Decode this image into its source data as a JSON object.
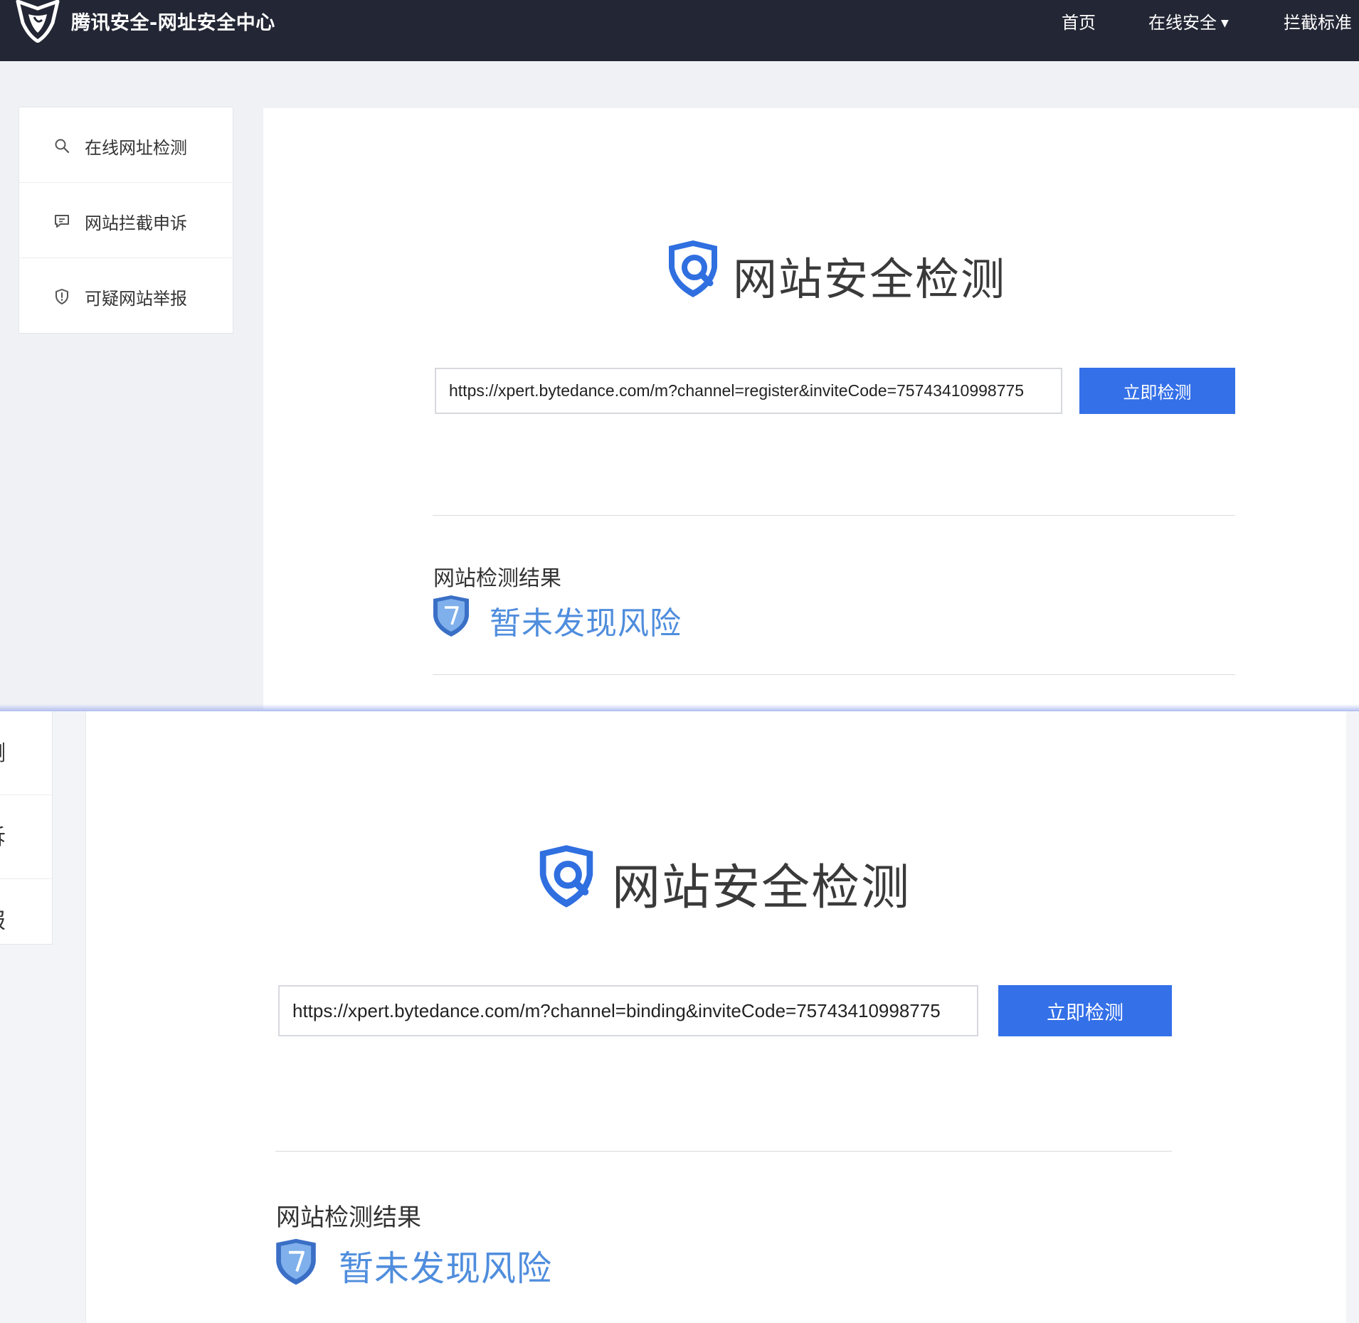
{
  "header": {
    "brand_title": "腾讯安全-网址安全中心",
    "nav": {
      "home": "首页",
      "online_security": "在线安全",
      "block_standard": "拦截标准"
    }
  },
  "sidebar": {
    "items": [
      {
        "label": "在线网址检测",
        "icon": "search-icon"
      },
      {
        "label": "网站拦截申诉",
        "icon": "chat-icon"
      },
      {
        "label": "可疑网站举报",
        "icon": "shield-alert-icon"
      }
    ],
    "partial_glyphs": [
      "测",
      "诉",
      "报"
    ]
  },
  "top_panel": {
    "hero_title": "网站安全检测",
    "url_value": "https://xpert.bytedance.com/m?channel=register&inviteCode=75743410998775",
    "button_label": "立即检测",
    "result_heading": "网站检测结果",
    "result_status": "暂未发现风险"
  },
  "bottom_panel": {
    "hero_title": "网站安全检测",
    "url_value": "https://xpert.bytedance.com/m?channel=binding&inviteCode=75743410998775",
    "button_label": "立即检测",
    "result_heading": "网站检测结果",
    "result_status": "暂未发现风险"
  },
  "colors": {
    "header_bg": "#232634",
    "primary_button": "#3470e8",
    "status_text": "#4f8ddd",
    "page_bg": "#f0f1f5"
  }
}
